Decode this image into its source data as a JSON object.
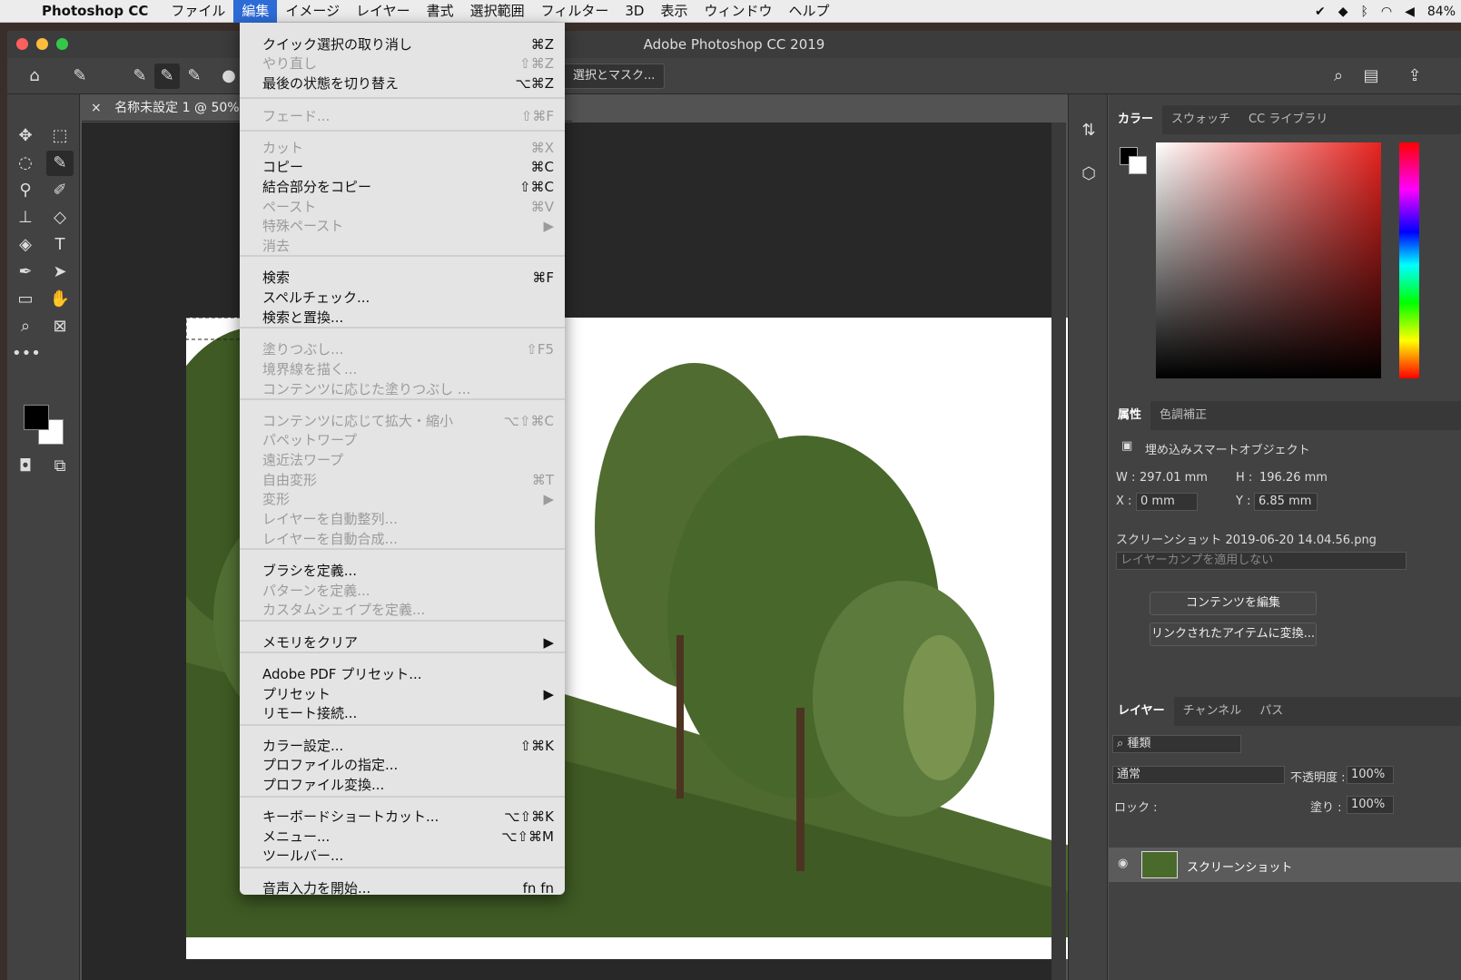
{
  "menubar": {
    "app_name": "Photoshop CC",
    "items": [
      "ファイル",
      "編集",
      "イメージ",
      "レイヤー",
      "書式",
      "選択範囲",
      "フィルター",
      "3D",
      "表示",
      "ウィンドウ",
      "ヘルプ"
    ],
    "active_index": 1,
    "battery": "84%"
  },
  "window": {
    "title": "Adobe Photoshop CC 2019",
    "doc_tab": "名称未設定 1 @ 50% (ス",
    "select_mask_button": "選択とマスク..."
  },
  "edit_menu": {
    "items": [
      {
        "label": "クイック選択の取り消し",
        "shortcut": "⌘Z",
        "disabled": false
      },
      {
        "label": "やり直し",
        "shortcut": "⇧⌘Z",
        "disabled": true
      },
      {
        "label": "最後の状態を切り替え",
        "shortcut": "⌥⌘Z",
        "disabled": false
      },
      {
        "label": "フェード...",
        "shortcut": "⇧⌘F",
        "disabled": true
      },
      {
        "label": "カット",
        "shortcut": "⌘X",
        "disabled": true
      },
      {
        "label": "コピー",
        "shortcut": "⌘C",
        "disabled": false
      },
      {
        "label": "結合部分をコピー",
        "shortcut": "⇧⌘C",
        "disabled": false
      },
      {
        "label": "ペースト",
        "shortcut": "⌘V",
        "disabled": true
      },
      {
        "label": "特殊ペースト",
        "shortcut": "▶",
        "disabled": true
      },
      {
        "label": "消去",
        "shortcut": "",
        "disabled": true
      },
      {
        "label": "検索",
        "shortcut": "⌘F",
        "disabled": false
      },
      {
        "label": "スペルチェック...",
        "shortcut": "",
        "disabled": false
      },
      {
        "label": "検索と置換...",
        "shortcut": "",
        "disabled": false
      },
      {
        "label": "塗りつぶし...",
        "shortcut": "⇧F5",
        "disabled": true
      },
      {
        "label": "境界線を描く...",
        "shortcut": "",
        "disabled": true
      },
      {
        "label": "コンテンツに応じた塗りつぶし ...",
        "shortcut": "",
        "disabled": true
      },
      {
        "label": "コンテンツに応じて拡大・縮小",
        "shortcut": "⌥⇧⌘C",
        "disabled": true
      },
      {
        "label": "パペットワープ",
        "shortcut": "",
        "disabled": true
      },
      {
        "label": "遠近法ワープ",
        "shortcut": "",
        "disabled": true
      },
      {
        "label": "自由変形",
        "shortcut": "⌘T",
        "disabled": true
      },
      {
        "label": "変形",
        "shortcut": "▶",
        "disabled": true
      },
      {
        "label": "レイヤーを自動整列...",
        "shortcut": "",
        "disabled": true
      },
      {
        "label": "レイヤーを自動合成...",
        "shortcut": "",
        "disabled": true
      },
      {
        "label": "ブラシを定義...",
        "shortcut": "",
        "disabled": false
      },
      {
        "label": "パターンを定義...",
        "shortcut": "",
        "disabled": true
      },
      {
        "label": "カスタムシェイプを定義...",
        "shortcut": "",
        "disabled": true
      },
      {
        "label": "メモリをクリア",
        "shortcut": "▶",
        "disabled": false
      },
      {
        "label": "Adobe PDF プリセット...",
        "shortcut": "",
        "disabled": false
      },
      {
        "label": "プリセット",
        "shortcut": "▶",
        "disabled": false
      },
      {
        "label": "リモート接続...",
        "shortcut": "",
        "disabled": false
      },
      {
        "label": "カラー設定...",
        "shortcut": "⇧⌘K",
        "disabled": false
      },
      {
        "label": "プロファイルの指定...",
        "shortcut": "",
        "disabled": false
      },
      {
        "label": "プロファイル変換...",
        "shortcut": "",
        "disabled": false
      },
      {
        "label": "キーボードショートカット...",
        "shortcut": "⌥⇧⌘K",
        "disabled": false
      },
      {
        "label": "メニュー...",
        "shortcut": "⌥⇧⌘M",
        "disabled": false
      },
      {
        "label": "ツールバー...",
        "shortcut": "",
        "disabled": false
      },
      {
        "label": "音声入力を開始...",
        "shortcut": "fn fn",
        "disabled": false
      }
    ]
  },
  "color_panel": {
    "tabs": [
      "カラー",
      "スウォッチ",
      "CC ライブラリ"
    ]
  },
  "properties_panel": {
    "tabs": [
      "属性",
      "色調補正"
    ],
    "object_type": "埋め込みスマートオブジェクト",
    "w_label": "W :",
    "w_value": "297.01 mm",
    "h_label": "H :",
    "h_value": "196.26 mm",
    "x_label": "X :",
    "x_value": "0 mm",
    "y_label": "Y :",
    "y_value": "6.85 mm",
    "filename": "スクリーンショット 2019-06-20 14.04.56.png",
    "layer_comp": "レイヤーカンプを適用しない",
    "edit_contents_button": "コンテンツを編集",
    "convert_linked_button": "リンクされたアイテムに変換..."
  },
  "layers_panel": {
    "tabs": [
      "レイヤー",
      "チャンネル",
      "パス"
    ],
    "filter": "種類",
    "blend_mode": "通常",
    "opacity_label": "不透明度 :",
    "opacity": "100%",
    "lock_label": "ロック :",
    "fill_label": "塗り :",
    "fill": "100%",
    "layer_name": "スクリーンショット"
  }
}
